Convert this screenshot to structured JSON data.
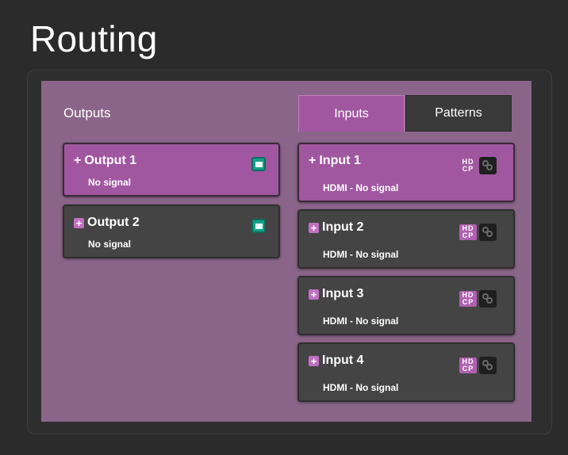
{
  "page": {
    "title": "Routing"
  },
  "outputs": {
    "label": "Outputs",
    "items": [
      {
        "name": "Output 1",
        "status": "No signal",
        "selected": true
      },
      {
        "name": "Output 2",
        "status": "No signal",
        "selected": false
      }
    ]
  },
  "tabs": [
    {
      "label": "Inputs",
      "active": true
    },
    {
      "label": "Patterns",
      "active": false
    }
  ],
  "inputs": {
    "items": [
      {
        "name": "Input 1",
        "status": "HDMI - No signal",
        "selected": true
      },
      {
        "name": "Input 2",
        "status": "HDMI - No signal",
        "selected": false
      },
      {
        "name": "Input 3",
        "status": "HDMI - No signal",
        "selected": false
      },
      {
        "name": "Input 4",
        "status": "HDMI - No signal",
        "selected": false
      }
    ],
    "hdcp_badge_top": "HD",
    "hdcp_badge_bottom": "CP"
  },
  "colors": {
    "background": "#2b2b2b",
    "panel": "#8a6589",
    "accent": "#a057a0",
    "card": "#444444",
    "video_icon": "#16a08a"
  },
  "icons": {
    "add": "plus-icon",
    "video": "video-icon",
    "hdcp": "hdcp-icon",
    "link": "link-icon"
  }
}
